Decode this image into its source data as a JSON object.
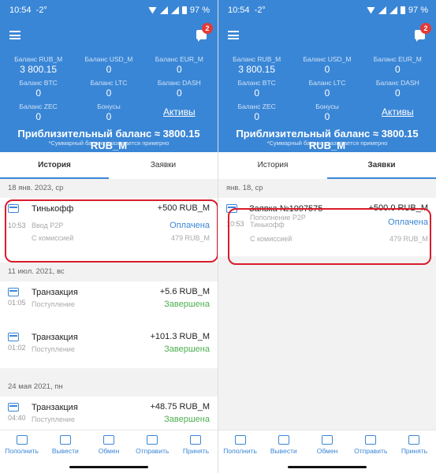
{
  "status_bar": {
    "time": "10:54",
    "temp": "-2°",
    "battery": "97 %"
  },
  "chat_badge": "2",
  "balances": {
    "rub_label": "Баланс RUB_M",
    "rub_value": "3 800.15",
    "usd_label": "Баланс USD_M",
    "usd_value": "0",
    "eur_label": "Баланс EUR_M",
    "eur_value": "0",
    "btc_label": "Баланс BTC",
    "btc_value": "0",
    "ltc_label": "Баланс LTC",
    "ltc_value": "0",
    "dash_label": "Баланс DASH",
    "dash_value": "0",
    "zec_label": "Баланс ZEC",
    "zec_value": "0",
    "bonus_label": "Бонусы",
    "bonus_value": "0",
    "assets_link": "Активы"
  },
  "approx_balance": "Приблизительный баланс ≈ 3800.15 RUB_M",
  "approx_note": "*Суммарный баланс указывается примерно",
  "tabs": {
    "history": "История",
    "requests": "Заявки"
  },
  "history": {
    "groups": [
      {
        "date": "18 янв. 2023, ср",
        "items": [
          {
            "title": "Тинькофф",
            "time": "10:53",
            "sub": "Ввод P2P",
            "amount": "+500 RUB_M",
            "status": "Оплачена",
            "fee_label": "С комиссией",
            "fee_value": "479 RUB_M"
          }
        ]
      },
      {
        "date": "11 июл. 2021, вс",
        "items": [
          {
            "title": "Транзакция",
            "time": "01:05",
            "sub": "Поступление",
            "amount": "+5.6 RUB_M",
            "status": "Завершена"
          },
          {
            "title": "Транзакция",
            "time": "01:02",
            "sub": "Поступление",
            "amount": "+101.3 RUB_M",
            "status": "Завершена"
          }
        ]
      },
      {
        "date": "24 мая 2021, пн",
        "items": [
          {
            "title": "Транзакция",
            "time": "04:40",
            "sub": "Поступление",
            "amount": "+48.75 RUB_M",
            "status": "Завершена"
          }
        ]
      }
    ]
  },
  "requests": {
    "date": "янв. 18, ср",
    "item": {
      "title": "Заявка №1097575",
      "time": "10:53",
      "sub": "Пополнение P2P",
      "sub2": "Тинькофф",
      "amount": "+500.0 RUB_M",
      "status": "Оплачена",
      "fee_label": "С комиссией",
      "fee_value": "479 RUB_M"
    }
  },
  "bottom_nav": {
    "deposit": "Пополнить",
    "withdraw": "Вывести",
    "exchange": "Обмен",
    "send": "Отправить",
    "receive": "Принять"
  },
  "colors": {
    "primary": "#3a86d6",
    "paid": "#3a86d6",
    "done": "#4caf50",
    "highlight": "#d91c2a"
  }
}
